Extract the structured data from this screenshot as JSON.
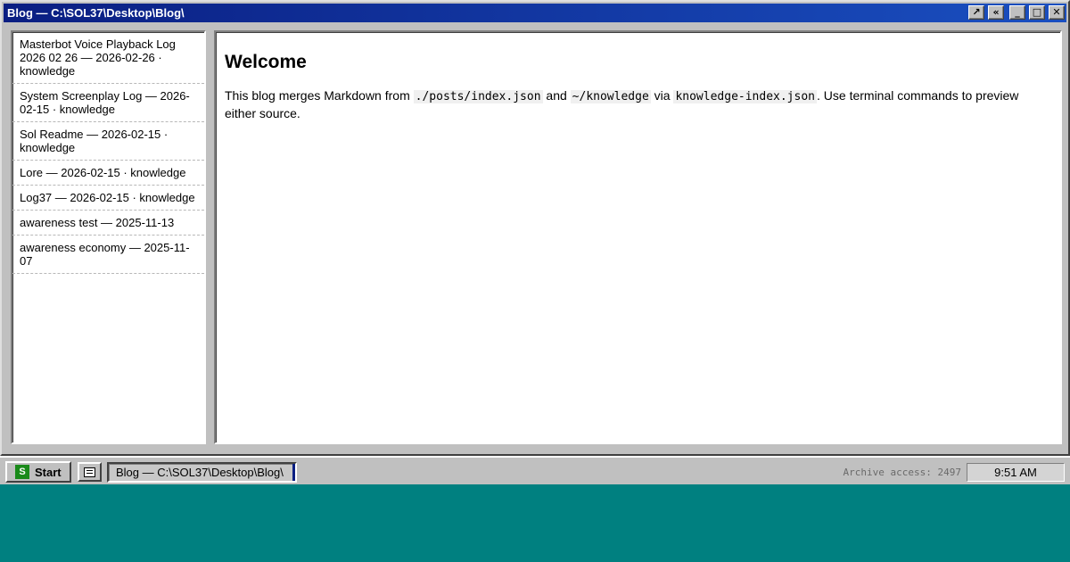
{
  "window": {
    "title": "Blog — C:\\SOL37\\Desktop\\Blog\\",
    "buttons": {
      "pin": "↗",
      "collapse": "«",
      "minimize": "_",
      "maximize": "□",
      "close": "✕"
    }
  },
  "sidebar": {
    "items": [
      {
        "label": "Masterbot Voice Playback Log 2026 02 26 — 2026-02-26 · knowledge"
      },
      {
        "label": "System Screenplay Log — 2026-02-15 · knowledge"
      },
      {
        "label": "Sol Readme — 2026-02-15 · knowledge"
      },
      {
        "label": "Lore — 2026-02-15 · knowledge"
      },
      {
        "label": "Log37 — 2026-02-15 · knowledge"
      },
      {
        "label": "awareness test — 2025-11-13"
      },
      {
        "label": "awareness economy — 2025-11-07"
      }
    ]
  },
  "main": {
    "title": "Welcome",
    "intro": {
      "t1": "This blog merges Markdown from ",
      "code1": "./posts/index.json",
      "t2": " and ",
      "code2": "~/knowledge",
      "t3": " via ",
      "code3": "knowledge-index.json",
      "t4": ". Use terminal commands to preview either source."
    }
  },
  "taskbar": {
    "start_logo": "S",
    "start_label": "Start",
    "task_label": "Blog — C:\\SOL37\\Desktop\\Blog\\",
    "status": "Archive access: 2497",
    "clock": "9:51 AM"
  },
  "colors": {
    "desktop": "#008080",
    "titlebar_start": "#0a1e82",
    "titlebar_end": "#1a4fc0",
    "chrome": "#c0c0c0",
    "start_logo": "#1a8a1a"
  }
}
